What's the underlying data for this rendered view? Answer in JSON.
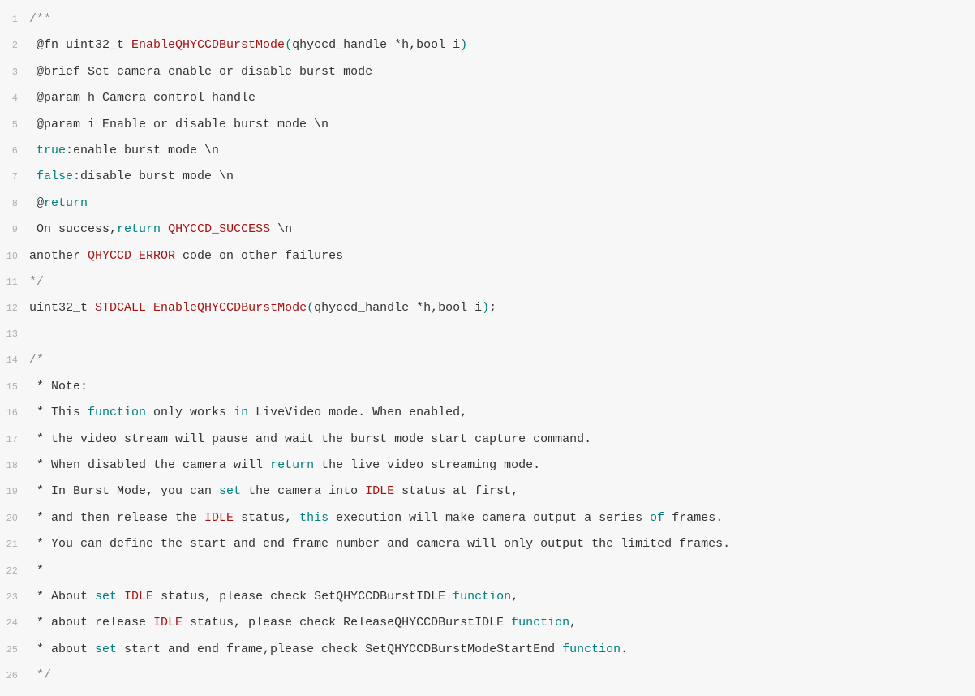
{
  "lines": [
    {
      "n": "1",
      "tokens": [
        {
          "t": "/**",
          "c": "c-comment"
        }
      ]
    },
    {
      "n": "2",
      "tokens": [
        {
          "t": " @fn uint32_t ",
          "c": ""
        },
        {
          "t": "EnableQHYCCDBurstMode",
          "c": "c-fn"
        },
        {
          "t": "(",
          "c": "c-paren"
        },
        {
          "t": "qhyccd_handle *h,bool i",
          "c": ""
        },
        {
          "t": ")",
          "c": "c-paren"
        }
      ]
    },
    {
      "n": "3",
      "tokens": [
        {
          "t": " @brief Set camera enable or disable burst mode",
          "c": ""
        }
      ]
    },
    {
      "n": "4",
      "tokens": [
        {
          "t": " @param h Camera control handle",
          "c": ""
        }
      ]
    },
    {
      "n": "5",
      "tokens": [
        {
          "t": " @param i Enable or disable burst mode \\n",
          "c": ""
        }
      ]
    },
    {
      "n": "6",
      "tokens": [
        {
          "t": " ",
          "c": ""
        },
        {
          "t": "true",
          "c": "c-kw"
        },
        {
          "t": ":enable burst mode \\n",
          "c": ""
        }
      ]
    },
    {
      "n": "7",
      "tokens": [
        {
          "t": " ",
          "c": ""
        },
        {
          "t": "false",
          "c": "c-kw"
        },
        {
          "t": ":disable burst mode \\n",
          "c": ""
        }
      ]
    },
    {
      "n": "8",
      "tokens": [
        {
          "t": " @",
          "c": ""
        },
        {
          "t": "return",
          "c": "c-kw"
        }
      ]
    },
    {
      "n": "9",
      "tokens": [
        {
          "t": " On success,",
          "c": ""
        },
        {
          "t": "return",
          "c": "c-kw"
        },
        {
          "t": " ",
          "c": ""
        },
        {
          "t": "QHYCCD_SUCCESS",
          "c": "c-const"
        },
        {
          "t": " \\n",
          "c": ""
        }
      ]
    },
    {
      "n": "10",
      "tokens": [
        {
          "t": "another ",
          "c": ""
        },
        {
          "t": "QHYCCD_ERROR",
          "c": "c-const"
        },
        {
          "t": " code on other failures",
          "c": ""
        }
      ]
    },
    {
      "n": "11",
      "tokens": [
        {
          "t": "*/",
          "c": "c-comment"
        }
      ]
    },
    {
      "n": "12",
      "tokens": [
        {
          "t": "uint32_t ",
          "c": ""
        },
        {
          "t": "STDCALL",
          "c": "c-const"
        },
        {
          "t": " ",
          "c": ""
        },
        {
          "t": "EnableQHYCCDBurstMode",
          "c": "c-fn"
        },
        {
          "t": "(",
          "c": "c-paren"
        },
        {
          "t": "qhyccd_handle *h,bool i",
          "c": ""
        },
        {
          "t": ")",
          "c": "c-paren"
        },
        {
          "t": ";",
          "c": ""
        }
      ]
    },
    {
      "n": "13",
      "tokens": [
        {
          "t": "",
          "c": ""
        }
      ]
    },
    {
      "n": "14",
      "tokens": [
        {
          "t": "/*",
          "c": "c-comment"
        }
      ]
    },
    {
      "n": "15",
      "tokens": [
        {
          "t": " * Note:",
          "c": ""
        }
      ]
    },
    {
      "n": "16",
      "tokens": [
        {
          "t": " * This ",
          "c": ""
        },
        {
          "t": "function",
          "c": "c-kw"
        },
        {
          "t": " only works ",
          "c": ""
        },
        {
          "t": "in",
          "c": "c-kw"
        },
        {
          "t": " LiveVideo mode. When enabled,",
          "c": ""
        }
      ]
    },
    {
      "n": "17",
      "tokens": [
        {
          "t": " * the video stream will pause and wait the burst mode start capture command.",
          "c": ""
        }
      ]
    },
    {
      "n": "18",
      "tokens": [
        {
          "t": " * When disabled the camera will ",
          "c": ""
        },
        {
          "t": "return",
          "c": "c-kw"
        },
        {
          "t": " the live video streaming mode.",
          "c": ""
        }
      ]
    },
    {
      "n": "19",
      "tokens": [
        {
          "t": " * In Burst Mode, you can ",
          "c": ""
        },
        {
          "t": "set",
          "c": "c-kw"
        },
        {
          "t": " the camera into ",
          "c": ""
        },
        {
          "t": "IDLE",
          "c": "c-const"
        },
        {
          "t": " status at first,",
          "c": ""
        }
      ]
    },
    {
      "n": "20",
      "tokens": [
        {
          "t": " * and then release the ",
          "c": ""
        },
        {
          "t": "IDLE",
          "c": "c-const"
        },
        {
          "t": " status, ",
          "c": ""
        },
        {
          "t": "this",
          "c": "c-kw"
        },
        {
          "t": " execution will make camera output a series ",
          "c": ""
        },
        {
          "t": "of",
          "c": "c-kw"
        },
        {
          "t": " frames.",
          "c": ""
        }
      ]
    },
    {
      "n": "21",
      "tokens": [
        {
          "t": " * You can define the start and end frame number and camera will only output the limited frames.",
          "c": ""
        }
      ]
    },
    {
      "n": "22",
      "tokens": [
        {
          "t": " *",
          "c": ""
        }
      ]
    },
    {
      "n": "23",
      "tokens": [
        {
          "t": " * About ",
          "c": ""
        },
        {
          "t": "set",
          "c": "c-kw"
        },
        {
          "t": " ",
          "c": ""
        },
        {
          "t": "IDLE",
          "c": "c-const"
        },
        {
          "t": " status, please check SetQHYCCDBurstIDLE ",
          "c": ""
        },
        {
          "t": "function",
          "c": "c-kw"
        },
        {
          "t": ",",
          "c": ""
        }
      ]
    },
    {
      "n": "24",
      "tokens": [
        {
          "t": " * about release ",
          "c": ""
        },
        {
          "t": "IDLE",
          "c": "c-const"
        },
        {
          "t": " status, please check ReleaseQHYCCDBurstIDLE ",
          "c": ""
        },
        {
          "t": "function",
          "c": "c-kw"
        },
        {
          "t": ",",
          "c": ""
        }
      ]
    },
    {
      "n": "25",
      "tokens": [
        {
          "t": " * about ",
          "c": ""
        },
        {
          "t": "set",
          "c": "c-kw"
        },
        {
          "t": " start and end frame,please check SetQHYCCDBurstModeStartEnd ",
          "c": ""
        },
        {
          "t": "function",
          "c": "c-kw"
        },
        {
          "t": ".",
          "c": ""
        }
      ]
    },
    {
      "n": "26",
      "tokens": [
        {
          "t": " */",
          "c": "c-comment"
        }
      ]
    }
  ]
}
